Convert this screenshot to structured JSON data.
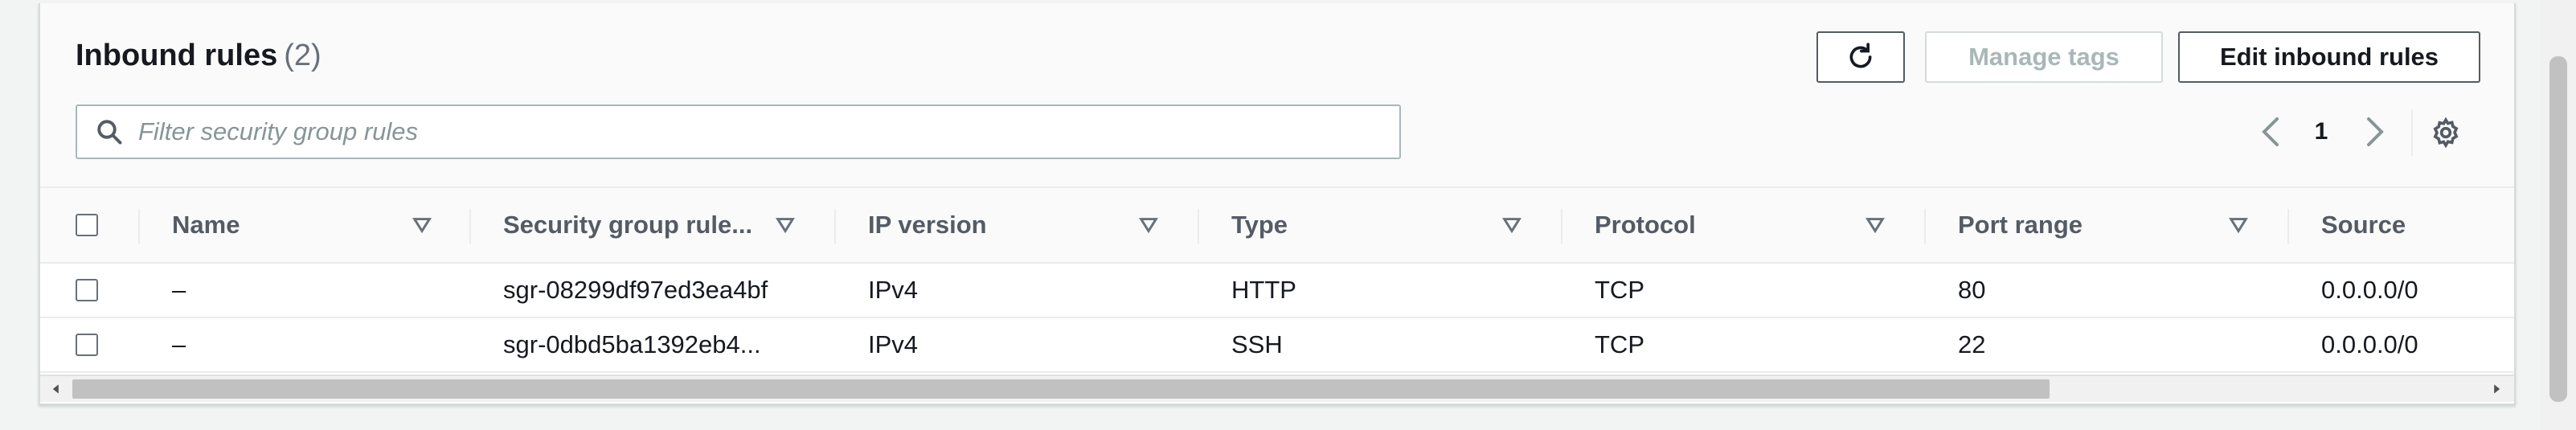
{
  "header": {
    "title": "Inbound rules",
    "count": "(2)"
  },
  "actions": {
    "refresh_icon": "refresh-icon",
    "manage_tags_label": "Manage tags",
    "edit_rules_label": "Edit inbound rules"
  },
  "search": {
    "placeholder": "Filter security group rules",
    "icon": "search-icon"
  },
  "pagination": {
    "current_page": "1",
    "prev_icon": "chevron-left-icon",
    "next_icon": "chevron-right-icon",
    "settings_icon": "gear-icon"
  },
  "table": {
    "columns": [
      {
        "label": "Name"
      },
      {
        "label": "Security group rule..."
      },
      {
        "label": "IP version"
      },
      {
        "label": "Type"
      },
      {
        "label": "Protocol"
      },
      {
        "label": "Port range"
      },
      {
        "label": "Source"
      }
    ],
    "rows": [
      {
        "name": "–",
        "rule_id": "sgr-08299df97ed3ea4bf",
        "ip_version": "IPv4",
        "type": "HTTP",
        "protocol": "TCP",
        "port_range": "80",
        "source": "0.0.0.0/0"
      },
      {
        "name": "–",
        "rule_id": "sgr-0dbd5ba1392eb4...",
        "ip_version": "IPv4",
        "type": "SSH",
        "protocol": "TCP",
        "port_range": "22",
        "source": "0.0.0.0/0"
      }
    ]
  },
  "colors": {
    "text": "#16191f",
    "muted": "#687078",
    "border": "#d5dbdb",
    "disabled": "#aab7b8"
  }
}
